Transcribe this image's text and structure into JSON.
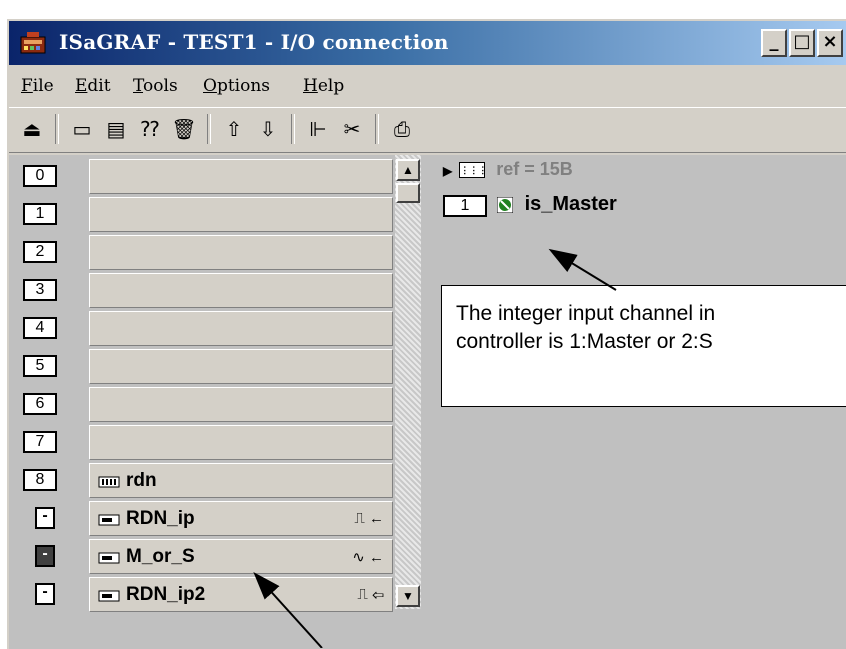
{
  "window": {
    "title": "ISaGRAF - TEST1 - I/O connection",
    "controls": {
      "minimize": "_",
      "maximize": "□",
      "close": "×"
    }
  },
  "menu": {
    "items": [
      {
        "label": "File",
        "underline": "F"
      },
      {
        "label": "Edit",
        "underline": "E"
      },
      {
        "label": "Tools",
        "underline": "T"
      },
      {
        "label": "Options",
        "underline": "O"
      },
      {
        "label": "Help",
        "underline": "H"
      }
    ]
  },
  "toolbar": {
    "icons": [
      "open-icon",
      "board-icon",
      "copy-board-icon",
      "help-board-icon",
      "trash-icon",
      "arrow-up-icon",
      "arrow-down-icon",
      "tree-icon",
      "cut-icon",
      "print-icon"
    ]
  },
  "slots": [
    {
      "number": "0",
      "label": ""
    },
    {
      "number": "1",
      "label": ""
    },
    {
      "number": "2",
      "label": ""
    },
    {
      "number": "3",
      "label": ""
    },
    {
      "number": "4",
      "label": ""
    },
    {
      "number": "5",
      "label": ""
    },
    {
      "number": "6",
      "label": ""
    },
    {
      "number": "7",
      "label": ""
    },
    {
      "number": "8",
      "label": "rdn"
    }
  ],
  "subboards": [
    {
      "box": "-",
      "label": "RDN_ip",
      "suffix": "⎍ ←",
      "selected": false
    },
    {
      "box": "-",
      "label": "M_or_S",
      "suffix": "∿ ←",
      "selected": true
    },
    {
      "box": "-",
      "label": "RDN_ip2",
      "suffix": "⎍ ⇦",
      "selected": false
    }
  ],
  "detail": {
    "ref_label": "ref = 15B",
    "channel_number": "1",
    "channel_name": "is_Master"
  },
  "callout": {
    "line1": "The integer input channel in",
    "line2": "controller is 1:Master or 2:S"
  },
  "colors": {
    "title_start": "#0a246a",
    "title_end": "#a6caf0",
    "panel": "#c0c0c0",
    "chrome": "#d4d0c8"
  }
}
